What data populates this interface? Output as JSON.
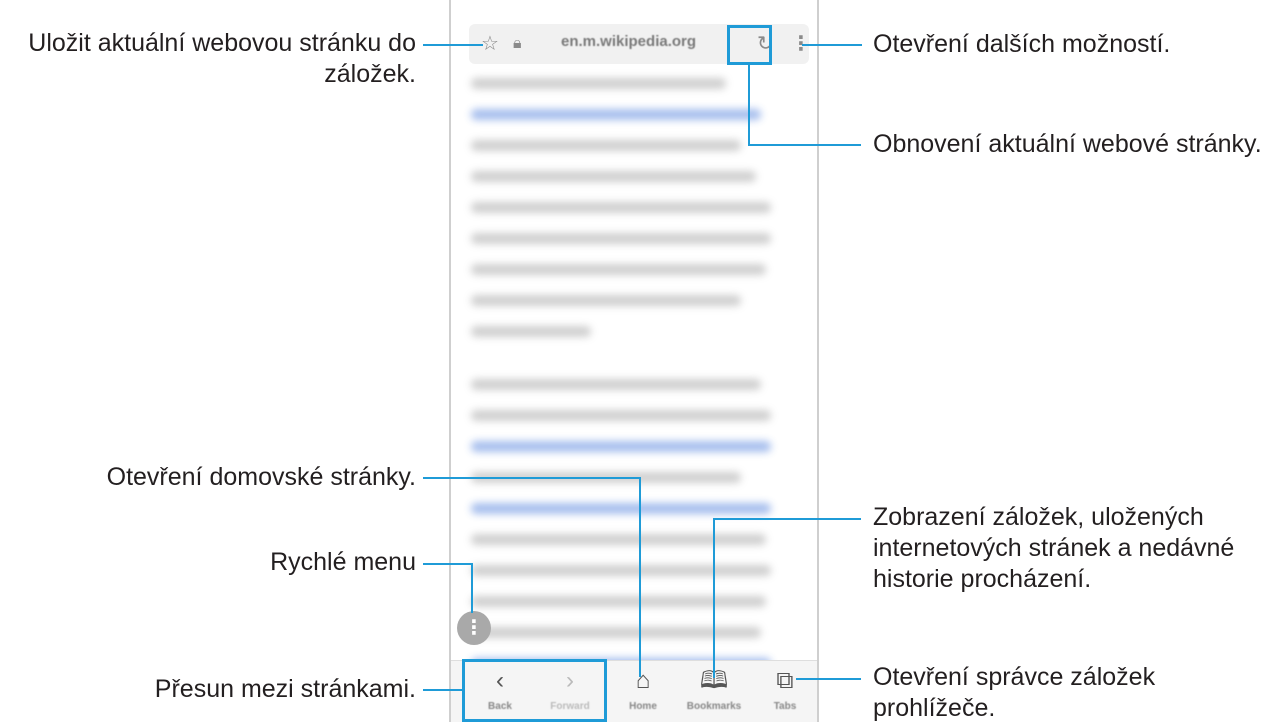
{
  "callouts": {
    "bookmark": "Uložit aktuální webovou stránku do",
    "bookmark_2": "záložek.",
    "more": "Otevření dalších možností.",
    "refresh": "Obnovení aktuální webové stránky.",
    "home": "Otevření domovské stránky.",
    "bookmarks_line1": "Zobrazení záložek, uložených",
    "bookmarks_line2": "internetových stránek a nedávné",
    "bookmarks_line3": "historie procházení.",
    "quick_menu": "Rychlé menu",
    "navigation": "Přesun mezi stránkami.",
    "tabs_line1": "Otevření správce záložek",
    "tabs_line2": "prohlížeče."
  },
  "browser": {
    "url": "en.m.wikipedia.org",
    "nav": {
      "back": "Back",
      "forward": "Forward",
      "home": "Home",
      "bookmarks": "Bookmarks",
      "tabs": "Tabs"
    }
  },
  "colors": {
    "accent": "#1f9bd7",
    "text": "#231f20"
  }
}
